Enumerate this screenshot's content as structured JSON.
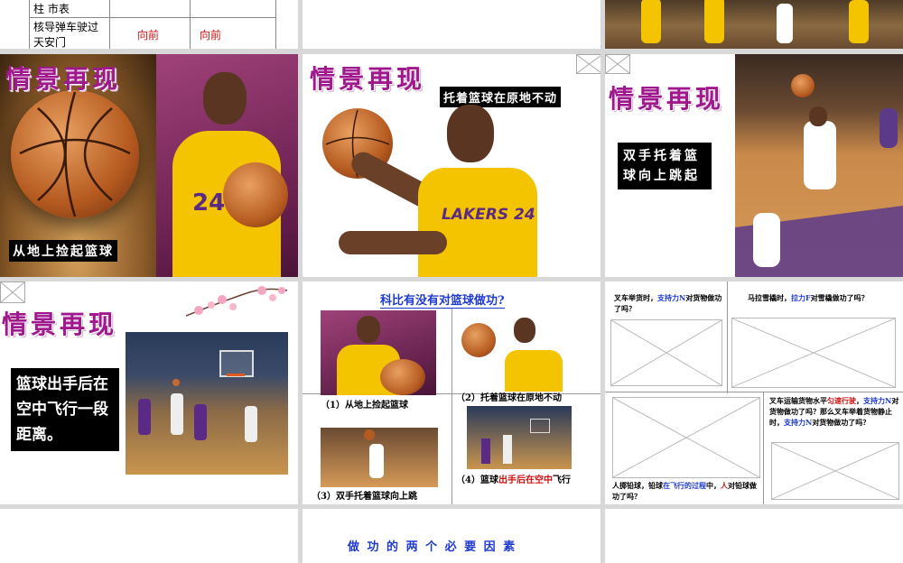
{
  "colors": {
    "title": "#a0188e",
    "accent_blue": "#1f3ad0",
    "accent_red": "#d01010",
    "lakers_yellow": "#f5c400",
    "lakers_purple": "#5b2a86"
  },
  "slide1": {
    "row1_c1": "柱  市表",
    "row2_c1": "核导弹车驶过天安门",
    "row2_c2": "向前",
    "row2_c3": "向前"
  },
  "slide4": {
    "title": "情景再现",
    "caption": "从地上捡起篮球"
  },
  "slide5": {
    "title": "情景再现",
    "caption": "托着篮球在原地不动",
    "jersey": "LAKERS 24"
  },
  "slide6": {
    "title": "情景再现",
    "caption": "双手托着篮球向上跳起"
  },
  "slide7": {
    "title": "情景再现",
    "caption": "篮球出手后在空中飞行一段距离。"
  },
  "slide8": {
    "title": "科比有没有对篮球做功?",
    "c1": "（1）从地上捡起篮球",
    "c2": "（2）托着篮球在原地不动",
    "c3": "（3）双手托着篮球向上跳",
    "c4_a": "（4）篮球",
    "c4_b": "出手后在空中",
    "c4_c": "飞行"
  },
  "slide9": {
    "q1_a": "叉车举货时，",
    "q1_b": "支持力N",
    "q1_c": "对货物做功了吗？",
    "q2_a": "马拉雪橇时，",
    "q2_b": "拉力F",
    "q2_c": "对雪橇做功了吗？",
    "q3_a": "叉车运输货物水平",
    "q3_b": "匀速行驶",
    "q3_c": "，",
    "q3_d": "支持力N",
    "q3_e": "对货物做功了吗？那么叉车举着货物静止时，",
    "q3_f": "支持力N",
    "q3_g": "对货物做功了吗？",
    "q4_a": "人掷铅球，铅球",
    "q4_b": "在飞行的过程",
    "q4_c": "中，",
    "q4_d": "人",
    "q4_e": "对铅球做功了吗？"
  },
  "slide11": {
    "partial_title": "做 功 的 两 个 必 要 因 素"
  }
}
